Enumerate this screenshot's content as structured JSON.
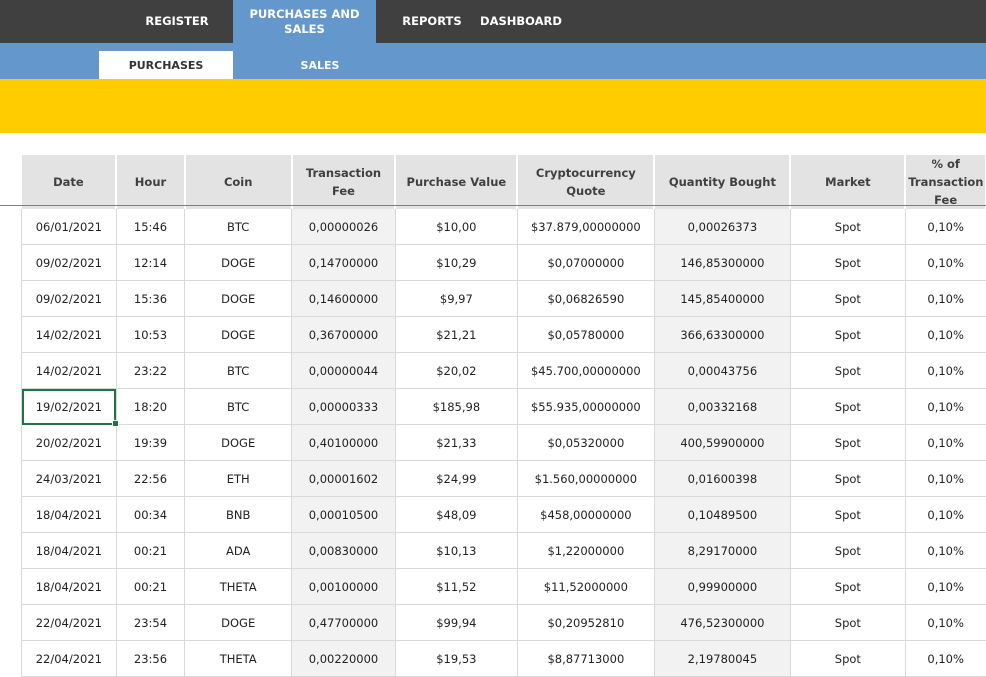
{
  "nav": {
    "items": [
      {
        "label": "REGISTER"
      },
      {
        "label_line1": "PURCHASES AND",
        "label_line2": "SALES"
      },
      {
        "label": "REPORTS"
      },
      {
        "label": "DASHBOARD"
      }
    ],
    "active": "PURCHASES AND SALES"
  },
  "subnav": {
    "items": [
      {
        "label": "PURCHASES"
      },
      {
        "label": "SALES"
      }
    ],
    "active": "PURCHASES"
  },
  "colors": {
    "topbar": "#404040",
    "accent_blue": "#6497cb",
    "banner_yellow": "#ffcc00",
    "header_gray": "#e3e3e3",
    "selection_green": "#217346"
  },
  "table": {
    "headers": [
      {
        "label": "Date"
      },
      {
        "label": "Hour"
      },
      {
        "label": "Coin"
      },
      {
        "label": "Transaction Fee"
      },
      {
        "label": "Purchase Value"
      },
      {
        "label": "Cryptocurrency Quote"
      },
      {
        "label": "Quantity Bought"
      },
      {
        "label": "Market"
      },
      {
        "label_line1": "% of",
        "label_line2": "Transaction",
        "label_line3": "Fee"
      }
    ],
    "rows": [
      [
        "06/01/2021",
        "15:46",
        "BTC",
        "0,00000026",
        "$10,00",
        "$37.879,00000000",
        "0,00026373",
        "Spot",
        "0,10%"
      ],
      [
        "09/02/2021",
        "12:14",
        "DOGE",
        "0,14700000",
        "$10,29",
        "$0,07000000",
        "146,85300000",
        "Spot",
        "0,10%"
      ],
      [
        "09/02/2021",
        "15:36",
        "DOGE",
        "0,14600000",
        "$9,97",
        "$0,06826590",
        "145,85400000",
        "Spot",
        "0,10%"
      ],
      [
        "14/02/2021",
        "10:53",
        "DOGE",
        "0,36700000",
        "$21,21",
        "$0,05780000",
        "366,63300000",
        "Spot",
        "0,10%"
      ],
      [
        "14/02/2021",
        "23:22",
        "BTC",
        "0,00000044",
        "$20,02",
        "$45.700,00000000",
        "0,00043756",
        "Spot",
        "0,10%"
      ],
      [
        "19/02/2021",
        "18:20",
        "BTC",
        "0,00000333",
        "$185,98",
        "$55.935,00000000",
        "0,00332168",
        "Spot",
        "0,10%"
      ],
      [
        "20/02/2021",
        "19:39",
        "DOGE",
        "0,40100000",
        "$21,33",
        "$0,05320000",
        "400,59900000",
        "Spot",
        "0,10%"
      ],
      [
        "24/03/2021",
        "22:56",
        "ETH",
        "0,00001602",
        "$24,99",
        "$1.560,00000000",
        "0,01600398",
        "Spot",
        "0,10%"
      ],
      [
        "18/04/2021",
        "00:34",
        "BNB",
        "0,00010500",
        "$48,09",
        "$458,00000000",
        "0,10489500",
        "Spot",
        "0,10%"
      ],
      [
        "18/04/2021",
        "00:21",
        "ADA",
        "0,00830000",
        "$10,13",
        "$1,22000000",
        "8,29170000",
        "Spot",
        "0,10%"
      ],
      [
        "18/04/2021",
        "00:21",
        "THETA",
        "0,00100000",
        "$11,52",
        "$11,52000000",
        "0,99900000",
        "Spot",
        "0,10%"
      ],
      [
        "22/04/2021",
        "23:54",
        "DOGE",
        "0,47700000",
        "$99,94",
        "$0,20952810",
        "476,52300000",
        "Spot",
        "0,10%"
      ],
      [
        "22/04/2021",
        "23:56",
        "THETA",
        "0,00220000",
        "$19,53",
        "$8,87713000",
        "2,19780045",
        "Spot",
        "0,10%"
      ]
    ],
    "selected_cell": {
      "row": 5,
      "col": 0
    }
  }
}
